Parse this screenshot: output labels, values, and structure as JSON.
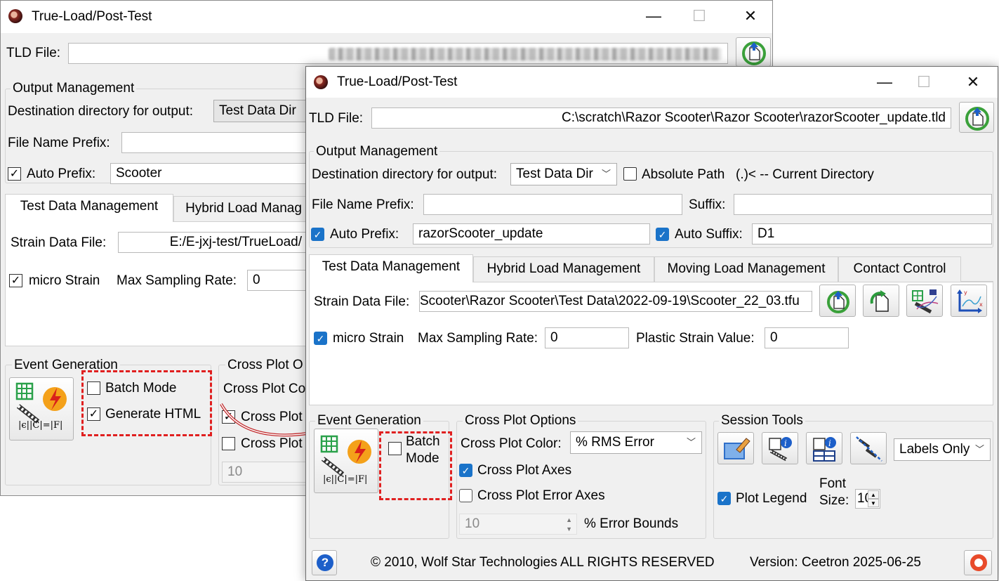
{
  "back": {
    "title": "True-Load/Post-Test",
    "tld_label": "TLD File:",
    "output_group": "Output Management",
    "dest_label": "Destination directory for output:",
    "dest_value": "Test Data Dir",
    "prefix_label": "File Name Prefix:",
    "auto_prefix_label": "Auto Prefix:",
    "auto_prefix_value": "Scooter",
    "tabs": [
      "Test Data Management",
      "Hybrid Load Manag"
    ],
    "strain_label": "Strain Data File:",
    "strain_value": "E:/E-jxj-test/TrueLoad/",
    "micro_strain": "micro Strain",
    "max_rate_label": "Max Sampling Rate:",
    "max_rate_value": "0",
    "event_group": "Event Generation",
    "batch_mode": "Batch Mode",
    "generate_html": "Generate HTML",
    "cross_group": "Cross Plot O",
    "cross_color_label": "Cross Plot Co",
    "cross_axes": "Cross Plot",
    "cross_err": "Cross Plot",
    "bounds_value": "10"
  },
  "front": {
    "title": "True-Load/Post-Test",
    "tld_label": "TLD File:",
    "tld_value": "C:\\scratch\\Razor Scooter\\Razor Scooter\\razorScooter_update.tld",
    "output_group": "Output Management",
    "dest_label": "Destination directory for output:",
    "dest_value": "Test Data Dir",
    "absolute_path": "Absolute Path",
    "current_dir": "(.)< -- Current Directory",
    "prefix_label": "File Name Prefix:",
    "suffix_label": "Suffix:",
    "auto_prefix_label": "Auto Prefix:",
    "auto_prefix_value": "razorScooter_update",
    "auto_suffix_label": "Auto Suffix:",
    "auto_suffix_value": "D1",
    "tabs": [
      "Test Data Management",
      "Hybrid Load Management",
      "Moving Load Management",
      "Contact Control"
    ],
    "strain_label": "Strain Data File:",
    "strain_value": "Scooter\\Razor Scooter\\Test Data\\2022-09-19\\Scooter_22_03.tfu",
    "micro_strain": "micro Strain",
    "max_rate_label": "Max Sampling Rate:",
    "max_rate_value": "0",
    "plastic_label": "Plastic Strain Value:",
    "plastic_value": "0",
    "event_group": "Event Generation",
    "batch_mode_1": "Batch",
    "batch_mode_2": "Mode",
    "cross_group": "Cross Plot Options",
    "cross_color_label": "Cross Plot Color:",
    "cross_color_value": "% RMS Error",
    "cross_axes": "Cross Plot Axes",
    "cross_err_axes": "Cross Plot Error Axes",
    "bounds_value": "10",
    "bounds_label": "% Error Bounds",
    "session_group": "Session Tools",
    "labels_value": "Labels Only",
    "plot_legend": "Plot Legend",
    "font_label_1": "Font",
    "font_label_2": "Size:",
    "font_value": "10",
    "copyright": "© 2010, Wolf Star Technologies  ALL RIGHTS RESERVED",
    "version": "Version:  Ceetron 2025-06-25"
  },
  "formula_text": "|ϵ||C|=|F|",
  "colors": {
    "accent_blue": "#1a73c9",
    "highlight_red": "#e02020",
    "arrow_red": "#c0282a"
  }
}
